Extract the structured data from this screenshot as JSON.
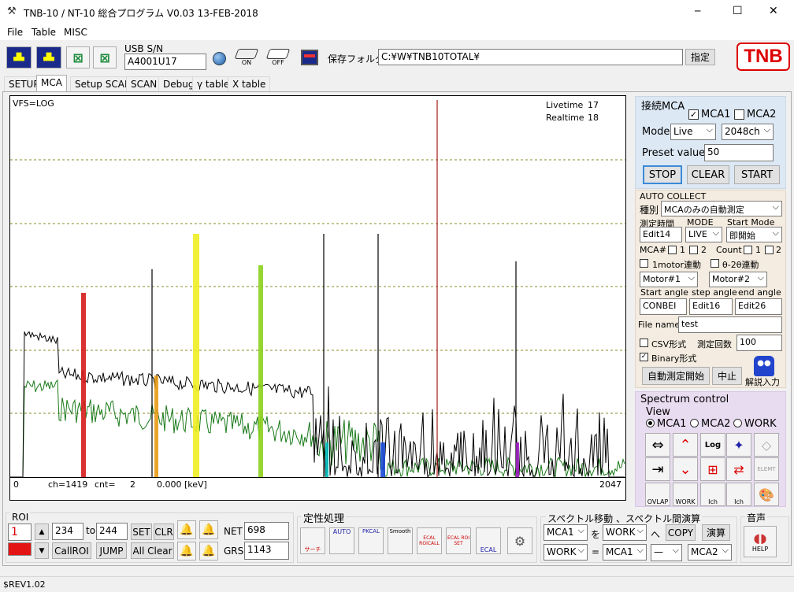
{
  "window": {
    "title": "TNB-10 / NT-10  総合プログラム  V0.03 13-FEB-2018",
    "minimize": "─",
    "maximize": "☐",
    "close": "✕"
  },
  "menu": [
    "File",
    "Table",
    "MISC"
  ],
  "toolbar": {
    "usb_label": "USB S/N",
    "usb_value": "A4001U17",
    "on_label": "ON",
    "off_label": "OFF",
    "folder_label": "保存フォルダ",
    "folder_value": "C:¥W¥TNB10TOTAL¥",
    "browse": "指定",
    "logo": "TNB"
  },
  "tabs": [
    "SETUP",
    "MCA",
    "Setup SCAN",
    "SCAN",
    "Debug",
    "γ table",
    "X table"
  ],
  "plot": {
    "vfs": "VFS=LOG",
    "livetime_label": "Livetime",
    "livetime": "17",
    "realtime_label": "Realtime",
    "realtime": "18",
    "x_min": "0",
    "x_max": "2047",
    "ch": "ch=1419",
    "cnt_label": "cnt=",
    "cnt": "2",
    "kev": "0.000 [keV]"
  },
  "chart_data": {
    "type": "line",
    "x_range": [
      0,
      2047
    ],
    "y_scale": "log",
    "grid": "dashed horizontal",
    "series": [
      {
        "name": "MCA1",
        "color": "#000000"
      },
      {
        "name": "MCA2",
        "color": "#1a7a1a"
      }
    ],
    "markers": [
      {
        "color": "#d61c1c"
      },
      {
        "color": "#e89a14"
      },
      {
        "color": "#eeee22"
      },
      {
        "color": "#8cd21c"
      },
      {
        "color": "#00bcbc"
      },
      {
        "color": "#1a4ad6"
      },
      {
        "color": "#9a1ac0"
      },
      {
        "color": "#c81e1e"
      }
    ]
  },
  "connect": {
    "title": "接続MCA",
    "mca1": "MCA1",
    "mca2": "MCA2",
    "mode_label": "Mode",
    "mode": "Live",
    "channels": "2048ch",
    "preset_label": "Preset value",
    "preset": "50",
    "stop": "STOP",
    "clear": "CLEAR",
    "start": "START"
  },
  "auto": {
    "title": "AUTO COLLECT",
    "kind_label": "種別",
    "kind": "MCAのみの自動測定",
    "time_label": "測定時間",
    "mode_label": "MODE",
    "startmode_label": "Start Mode",
    "time": "Edit14",
    "mode": "LIVE",
    "startmode": "即開始",
    "mca_label": "MCA#",
    "one": "1",
    "two": "2",
    "count_label": "Count",
    "motor_link": "1motor連動",
    "theta_link": "θ-2θ連動",
    "motor1": "Motor#1",
    "motor2": "Motor#2",
    "start_angle_label": "Start angle",
    "step_angle_label": "step angle",
    "end_angle_label": "end angle",
    "start_angle": "CONBEI",
    "step_angle": "Edit16",
    "end_angle": "Edit26",
    "filename_label": "File name",
    "filename": "test",
    "csv": "CSV形式",
    "count2_label": "測定回数",
    "count2": "100",
    "binary": "Binary形式",
    "begin": "自動測定開始",
    "stop": "中止",
    "kaisetsu": "解説入力"
  },
  "spectrum": {
    "title": "Spectrum control",
    "view": "View",
    "mca1": "MCA1",
    "mca2": "MCA2",
    "work": "WORK",
    "icons": [
      "⇔",
      "⌃",
      "Log",
      "✦",
      "◇",
      "⇥",
      "⌄",
      "⊞",
      "⇄",
      "ELEMT",
      "OVLAP",
      "WORK",
      "Ich",
      "Ich",
      "🎨"
    ]
  },
  "roi": {
    "title": "ROI",
    "number": "1",
    "from": "234",
    "to_label": "to",
    "to": "244",
    "set": "SET",
    "clr": "CLR",
    "call": "CallROI",
    "jump": "JUMP",
    "allclear": "All Clear",
    "net_label": "NET",
    "net": "698",
    "grs_label": "GRS",
    "grs": "1143"
  },
  "qual": {
    "title": "定性処理",
    "icons": [
      "サーチ",
      "AUTO",
      "PKCAL",
      "Smooth",
      "ECAL ROICALL",
      "ECAL ROI SET",
      "ECAL",
      ""
    ]
  },
  "move": {
    "title": "スペクトル移動 、スペクトル間演算",
    "src": "MCA1",
    "wo": "を",
    "dst": "WORK",
    "he": "へ",
    "copy": "COPY",
    "op": "演算",
    "a": "WORK",
    "eq": "=",
    "b": "MCA1",
    "operator": "—",
    "c": "MCA2"
  },
  "sound": {
    "title": "音声",
    "help": "HELP"
  },
  "status": "$REV1.02"
}
